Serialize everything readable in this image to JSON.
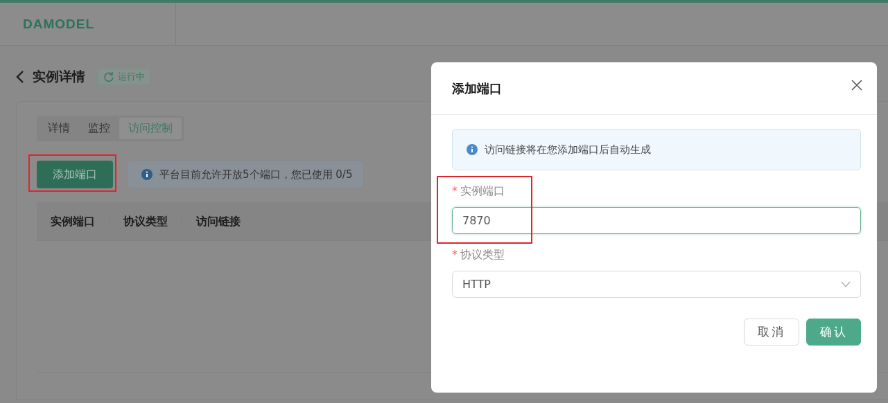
{
  "header": {
    "logo": "DAMODEL"
  },
  "page": {
    "title": "实例详情",
    "status": {
      "label": "运行中"
    }
  },
  "tabs": [
    {
      "label": "详情",
      "selected": false
    },
    {
      "label": "监控",
      "selected": false
    },
    {
      "label": "访问控制",
      "selected": true
    }
  ],
  "toolbar": {
    "add_button": {
      "label": "添加端口",
      "highlighted": true
    },
    "notice": "平台目前允许开放5个端口，您已使用 0/5"
  },
  "table": {
    "columns": [
      "实例端口",
      "协议类型",
      "访问链接"
    ]
  },
  "dialog": {
    "title": "添加端口",
    "notice": "访问链接将在您添加端口后自动生成",
    "fields": [
      {
        "kind": "input",
        "required_mark": "*",
        "label": "实例端口",
        "value": "7870",
        "focused": true,
        "highlighted": true
      },
      {
        "kind": "select",
        "required_mark": "*",
        "label": "协议类型",
        "value": "HTTP",
        "focused": false
      }
    ],
    "buttons": [
      {
        "label": "取消",
        "primary": false
      },
      {
        "label": "确认",
        "primary": true
      }
    ]
  }
}
